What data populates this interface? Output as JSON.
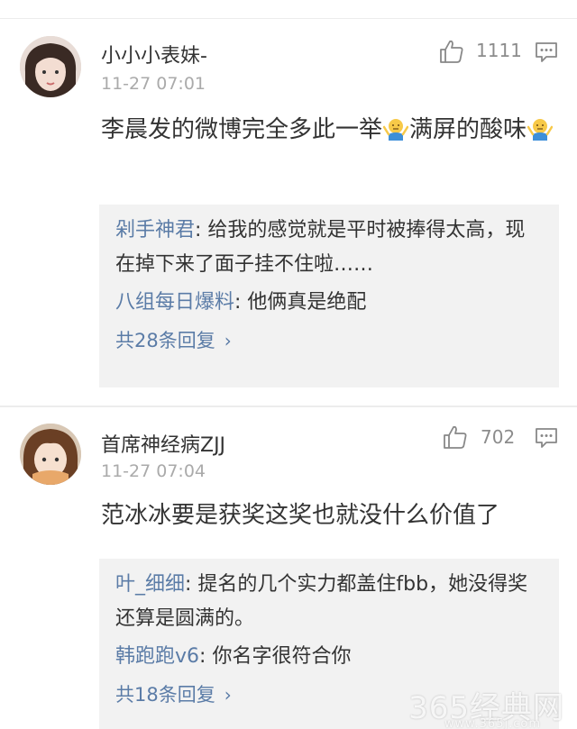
{
  "comments": [
    {
      "user": "小小小表妹-",
      "time": "11-27 07:01",
      "likes": "1111",
      "content_part1": "李晨发的微博完全多此一举",
      "content_part2": "满屏的酸味",
      "replies": [
        {
          "name": "剁手神君",
          "sep": ": ",
          "text": "给我的感觉就是平时被捧得太高，现在掉下来了面子挂不住啦……"
        },
        {
          "name": "八组每日爆料",
          "sep": ": ",
          "text": "他俩真是绝配"
        }
      ],
      "more_replies": "共28条回复"
    },
    {
      "user": "首席神经病ZJJ",
      "time": "11-27 07:04",
      "likes": "702",
      "content": "范冰冰要是获奖这奖也就没什么价值了",
      "replies": [
        {
          "name": "叶_细细",
          "sep": ": ",
          "text": "提名的几个实力都盖住fbb，她没得奖还算是圆满的。"
        },
        {
          "name": "韩跑跑v6",
          "sep": ": ",
          "text": "你名字很符合你"
        }
      ],
      "more_replies": "共18条回复"
    }
  ],
  "icons": {
    "like": "thumbs-up-icon",
    "reply": "comment-bubble-icon",
    "emoji": "shrug-emoji",
    "chevron": "chevron-right-icon"
  },
  "colors": {
    "link_blue": "#5b7ca7",
    "reply_bg": "#f2f2f2",
    "meta_gray": "#aaaaaa"
  },
  "watermark": {
    "main": "365经典网",
    "sub": "www.365j.com"
  }
}
